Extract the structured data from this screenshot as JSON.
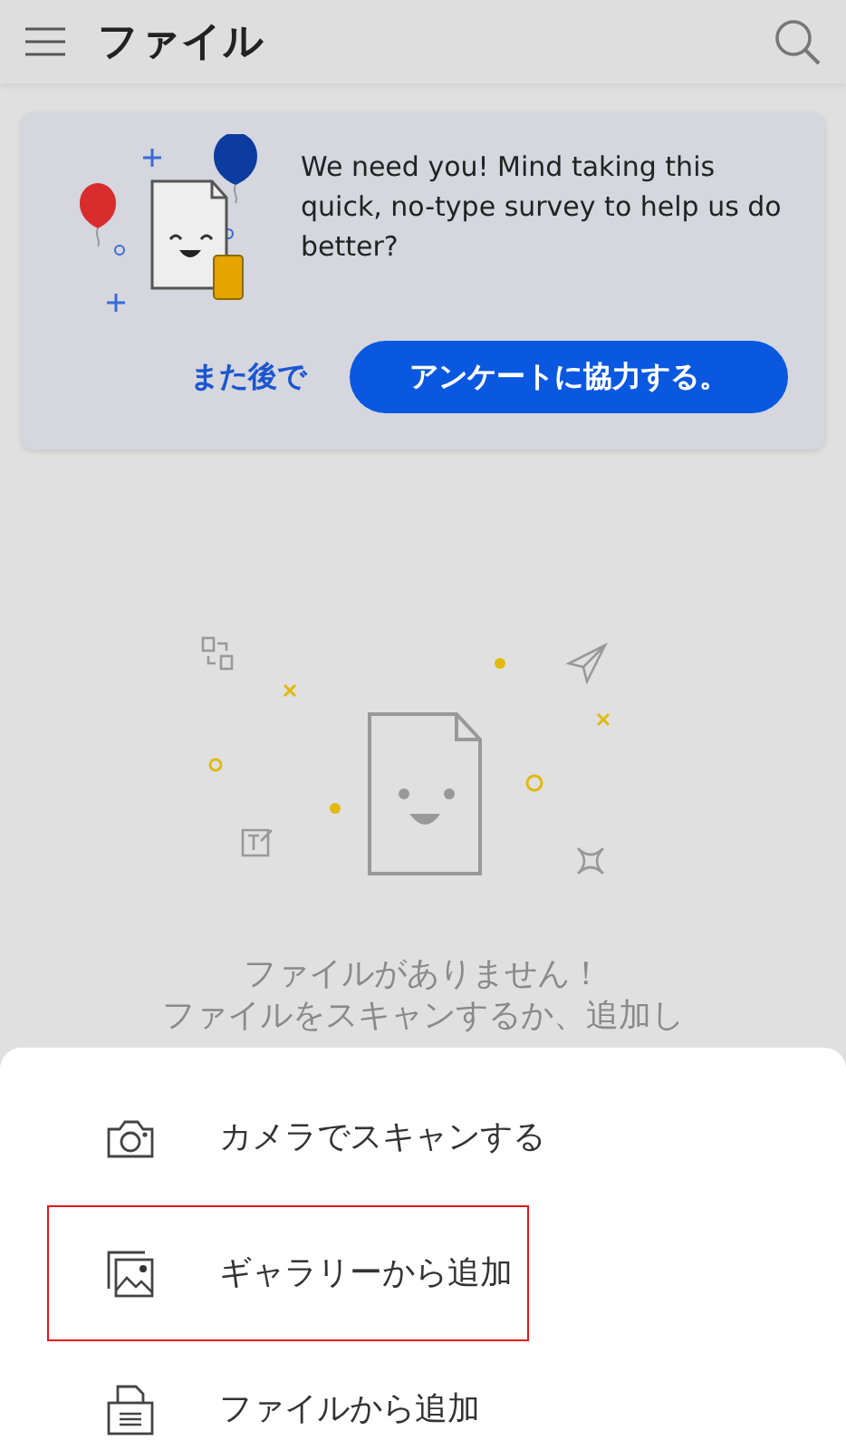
{
  "header": {
    "title": "ファイル"
  },
  "survey": {
    "message": "We need you! Mind taking this quick, no-type survey to help us do better?",
    "later": "また後で",
    "accept": "アンケートに協力する。"
  },
  "empty_state": {
    "lines": [
      "ファイルがありません！",
      "ファイルをスキャンするか、追加し"
    ]
  },
  "sheet": {
    "items": [
      {
        "kind": "camera",
        "label": "カメラでスキャンする",
        "highlighted": false
      },
      {
        "kind": "gallery",
        "label": "ギャラリーから追加",
        "highlighted": true
      },
      {
        "kind": "file",
        "label": "ファイルから追加",
        "highlighted": false
      }
    ]
  }
}
